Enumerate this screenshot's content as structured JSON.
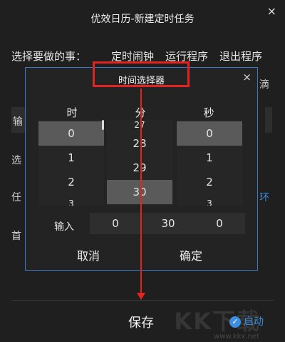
{
  "window": {
    "title": "优效日历-新建定时任务",
    "close_symbol": "×"
  },
  "task": {
    "label": "选择要做的事：",
    "options": [
      "定时闹钟",
      "运行程序",
      "退出程序"
    ]
  },
  "background_partials": {
    "row2_right": "滴",
    "row3_left": "输",
    "row4_left": "选",
    "row5_left": "任",
    "row5_right": "环",
    "row6_left": "首"
  },
  "dialog": {
    "title": "时间选择器",
    "close_symbol": "×",
    "columns": [
      {
        "header": "时",
        "top_partial": "",
        "items": [
          "0",
          "1",
          "2"
        ],
        "bottom_partial": "3",
        "selected": "0"
      },
      {
        "header": "分",
        "top_partial": "27",
        "items": [
          "28",
          "29",
          "30"
        ],
        "bottom_partial": "",
        "selected": "30"
      },
      {
        "header": "秒",
        "top_partial": "",
        "items": [
          "0",
          "1",
          "2"
        ],
        "bottom_partial": "3",
        "selected": "0"
      }
    ],
    "input_label": "输入",
    "inputs": [
      "0",
      "30",
      "0"
    ],
    "cancel_label": "取消",
    "confirm_label": "确定"
  },
  "footer": {
    "save_label": "保存",
    "start_label": "启动",
    "start_icon": "✓"
  },
  "watermark": {
    "text": "KK下载",
    "url": "www.kkx.net"
  },
  "annotation_color": "#e52222",
  "accent_color": "#3b8ee0"
}
